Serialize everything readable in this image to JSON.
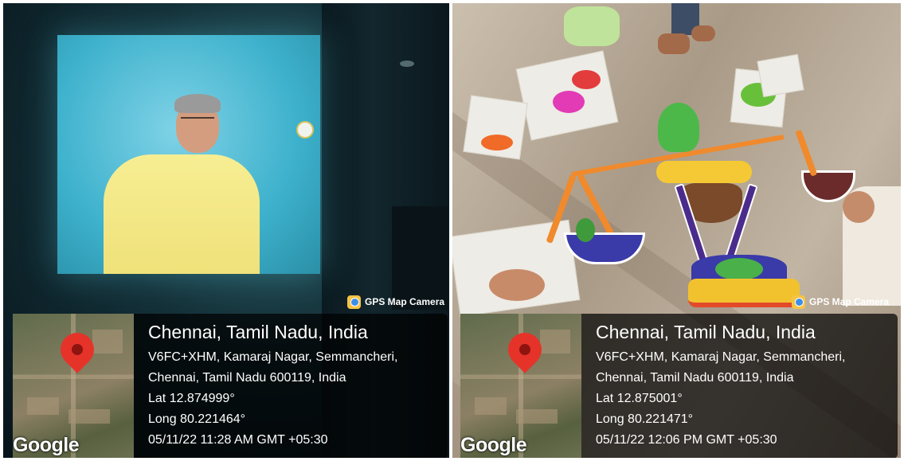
{
  "photos": [
    {
      "subject": "projection-screen",
      "gps_badge": "GPS Map Camera",
      "map_brand": "Google",
      "city": "Chennai, Tamil Nadu, India",
      "address_line1": "V6FC+XHM, Kamaraj Nagar, Semmancheri,",
      "address_line2": "Chennai, Tamil Nadu 600119, India",
      "lat": "Lat 12.874999°",
      "long": "Long 80.221464°",
      "timestamp": "05/11/22 11:28 AM GMT +05:30"
    },
    {
      "subject": "rangoli-floor",
      "gps_badge": "GPS Map Camera",
      "map_brand": "Google",
      "city": "Chennai, Tamil Nadu, India",
      "address_line1": "V6FC+XHM, Kamaraj Nagar, Semmancheri,",
      "address_line2": "Chennai, Tamil Nadu 600119, India",
      "lat": "Lat 12.875001°",
      "long": "Long 80.221471°",
      "timestamp": "05/11/22 12:06 PM GMT +05:30"
    }
  ],
  "colors": {
    "pin": "#e5332a",
    "overlay_bg": "rgba(0,0,0,0.72)",
    "screen": "#3db1cc",
    "rangoli_orange": "#f08a2c",
    "rangoli_green": "#4cb84a"
  }
}
